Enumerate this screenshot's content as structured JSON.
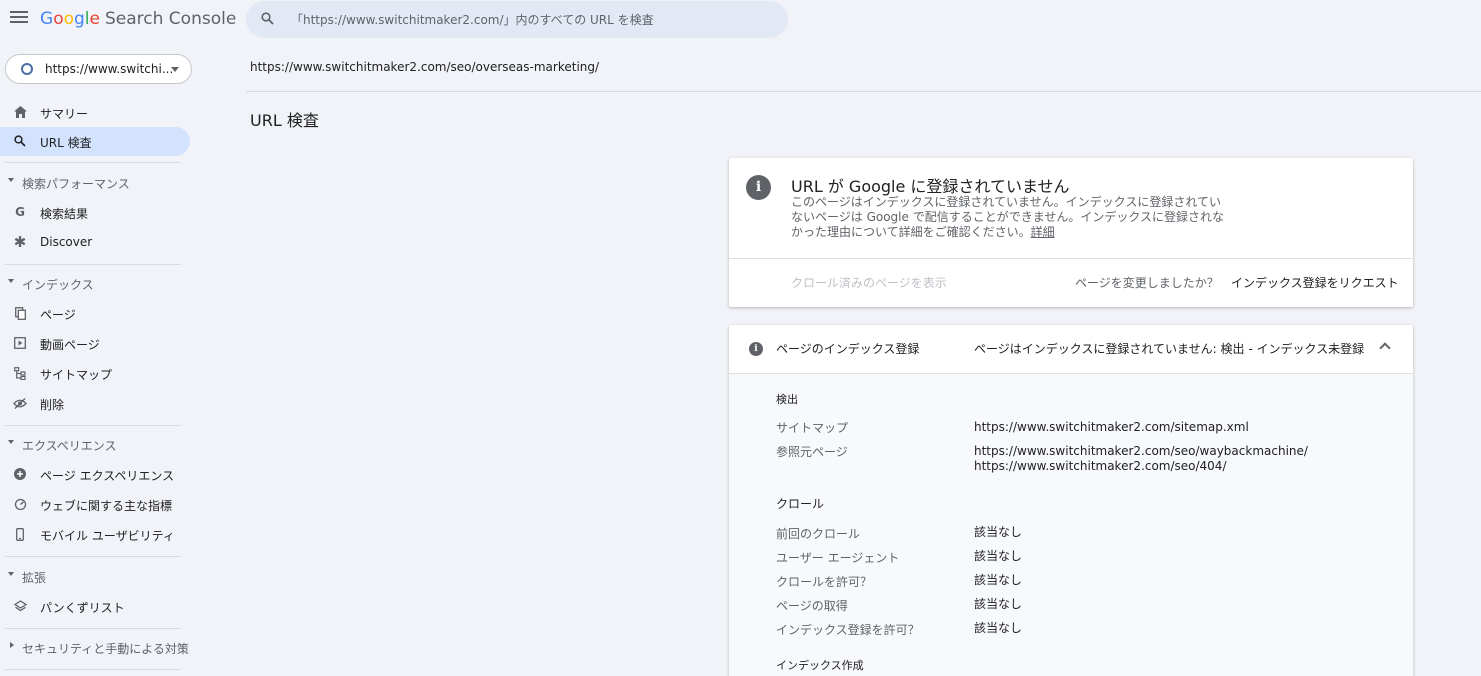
{
  "header": {
    "logo_google": "Google",
    "logo_product": "Search Console",
    "search_placeholder": "「https://www.switchitmaker2.com/」内のすべての URL を検査"
  },
  "sidebar": {
    "property": "https://www.switchi...",
    "items": [
      {
        "label": "サマリー",
        "icon": "home-icon"
      },
      {
        "label": "URL 検査",
        "icon": "search-icon",
        "active": true
      }
    ],
    "sections": [
      {
        "label": "検索パフォーマンス",
        "items": [
          {
            "label": "検索結果",
            "icon": "google-g-icon"
          },
          {
            "label": "Discover",
            "icon": "asterisk-icon"
          }
        ]
      },
      {
        "label": "インデックス",
        "items": [
          {
            "label": "ページ",
            "icon": "pages-icon"
          },
          {
            "label": "動画ページ",
            "icon": "video-page-icon"
          },
          {
            "label": "サイトマップ",
            "icon": "sitemap-icon"
          },
          {
            "label": "削除",
            "icon": "eye-off-icon"
          }
        ]
      },
      {
        "label": "エクスペリエンス",
        "items": [
          {
            "label": "ページ エクスペリエンス",
            "icon": "plus-circle-icon"
          },
          {
            "label": "ウェブに関する主な指標",
            "icon": "gauge-icon"
          },
          {
            "label": "モバイル ユーザビリティ",
            "icon": "phone-icon"
          }
        ]
      },
      {
        "label": "拡張",
        "items": [
          {
            "label": "パンくずリスト",
            "icon": "layers-icon"
          }
        ]
      },
      {
        "label": "セキュリティと手動による対策",
        "items": []
      }
    ]
  },
  "main": {
    "inspected_url": "https://www.switchitmaker2.com/seo/overseas-marketing/",
    "title": "URL 検査",
    "status_card": {
      "title": "URL が Google に登録されていません",
      "description_line1": "このページはインデックスに登録されていません。インデックスに登録されてい",
      "description_line2": "ないページは Google で配信することができません。インデックスに登録されな",
      "description_line3": "かった理由について詳細をご確認ください。",
      "details_link": "詳細",
      "view_crawled": "クロール済みのページを表示",
      "page_changed": "ページを変更しましたか？",
      "request_indexing": "インデックス登録をリクエスト"
    },
    "index_card": {
      "label": "ページのインデックス登録",
      "status": "ページはインデックスに登録されていません: 検出 - インデックス未登録",
      "discovery_heading": "検出",
      "sitemap_key": "サイトマップ",
      "sitemap_value": "https://www.switchitmaker2.com/sitemap.xml",
      "referring_key": "参照元ページ",
      "referring_value_1": "https://www.switchitmaker2.com/seo/waybackmachine/",
      "referring_value_2": "https://www.switchitmaker2.com/seo/404/",
      "crawl_heading": "クロール",
      "last_crawl_key": "前回のクロール",
      "last_crawl_value": "該当なし",
      "user_agent_key": "ユーザー エージェント",
      "user_agent_value": "該当なし",
      "crawl_allowed_key": "クロールを許可？",
      "crawl_allowed_value": "該当なし",
      "page_fetch_key": "ページの取得",
      "page_fetch_value": "該当なし",
      "indexing_allowed_key": "インデックス登録を許可？",
      "indexing_allowed_value": "該当なし",
      "indexing_heading": "インデックス作成"
    }
  }
}
